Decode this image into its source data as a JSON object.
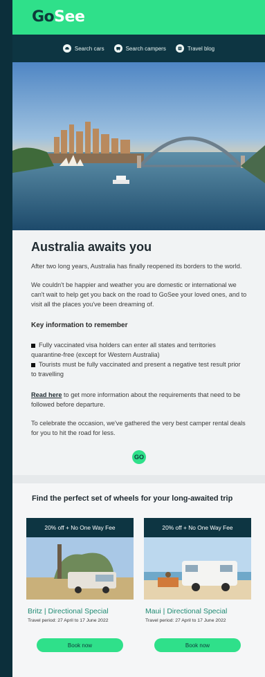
{
  "brand": {
    "logo_go": "Go",
    "logo_see": "See",
    "accent": "#2fe08a",
    "dark": "#0d3542"
  },
  "nav": {
    "items": [
      {
        "label": "Search cars",
        "icon": "car-icon"
      },
      {
        "label": "Search campers",
        "icon": "camper-icon"
      },
      {
        "label": "Travel blog",
        "icon": "blog-icon"
      }
    ]
  },
  "hero": {
    "alt": "Sydney harbour skyline"
  },
  "article": {
    "title": "Australia awaits you",
    "p1": "After two long years, Australia has finally reopened its borders to the world.",
    "p2": "We couldn't be happier and weather you are domestic or international we can't wait to help get you back on the road to GoSee your loved ones, and to visit all the places you've been dreaming of.",
    "key_heading": "Key information to remember",
    "bullet1": "Fully vaccinated visa holders can enter all states and territories quarantine-free (except for Western Australia)",
    "bullet2": "Tourists must be fully vaccinated and present a negative test result prior to travelling",
    "read_link": "Read here",
    "read_rest": " to get more information about the requirements that need to be followed before departure.",
    "p4": "To celebrate the occasion, we've gathered the very best camper rental deals for you to hit the road for less.",
    "badge": "GO"
  },
  "wheels": {
    "heading": "Find the perfect set of wheels for your long-awaited trip",
    "cards": [
      {
        "banner": "20% off + No One Way Fee",
        "title": "Britz | Directional Special",
        "period": "Travel period: 27 April to 17 June 2022",
        "button": "Book now"
      },
      {
        "banner": "20% off + No One Way Fee",
        "title": "Maui | Directional Special",
        "period": "Travel period: 27 April to 17 June 2022",
        "button": "Book now"
      }
    ]
  }
}
